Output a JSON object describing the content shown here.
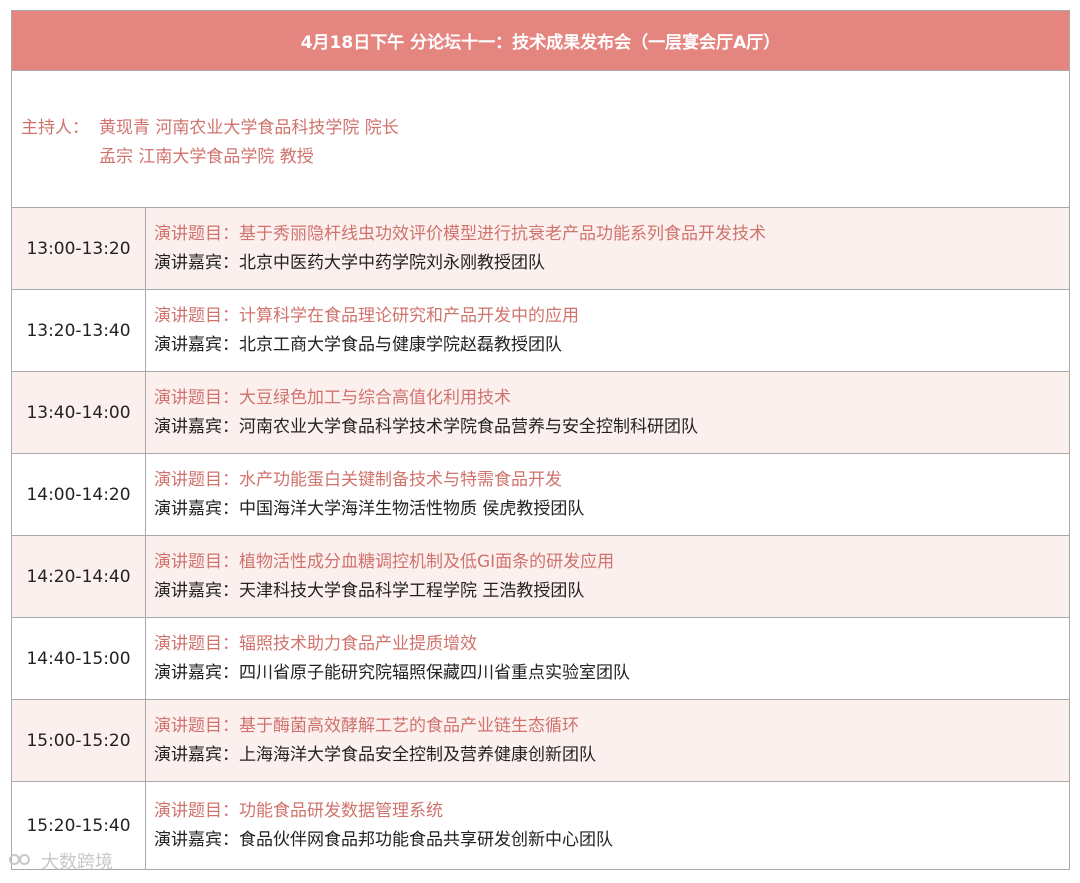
{
  "header": {
    "title": "4月18日下午 分论坛十一：技术成果发布会（一层宴会厅A厅）"
  },
  "hosts": {
    "label": "主持人：",
    "lines": [
      "黄现青 河南农业大学食品科技学院 院长",
      "孟宗 江南大学食品学院 教授"
    ]
  },
  "sessions": [
    {
      "time": "13:00-13:20",
      "topic": "演讲题目：基于秀丽隐杆线虫功效评价模型进行抗衰老产品功能系列食品开发技术",
      "speaker": "演讲嘉宾：北京中医药大学中药学院刘永刚教授团队"
    },
    {
      "time": "13:20-13:40",
      "topic": "演讲题目：计算科学在食品理论研究和产品开发中的应用",
      "speaker": "演讲嘉宾：北京工商大学食品与健康学院赵磊教授团队"
    },
    {
      "time": "13:40-14:00",
      "topic": "演讲题目：大豆绿色加工与综合高值化利用技术",
      "speaker": "演讲嘉宾：河南农业大学食品科学技术学院食品营养与安全控制科研团队"
    },
    {
      "time": "14:00-14:20",
      "topic": "演讲题目：水产功能蛋白关键制备技术与特需食品开发",
      "speaker": "演讲嘉宾：中国海洋大学海洋生物活性物质 侯虎教授团队"
    },
    {
      "time": "14:20-14:40",
      "topic": "演讲题目：植物活性成分血糖调控机制及低GI面条的研发应用",
      "speaker": "演讲嘉宾：天津科技大学食品科学工程学院 王浩教授团队"
    },
    {
      "time": "14:40-15:00",
      "topic": "演讲题目：辐照技术助力食品产业提质增效",
      "speaker": "演讲嘉宾：四川省原子能研究院辐照保藏四川省重点实验室团队"
    },
    {
      "time": "15:00-15:20",
      "topic": "演讲题目：基于酶菌高效酵解工艺的食品产业链生态循环",
      "speaker": "演讲嘉宾：上海海洋大学食品安全控制及营养健康创新团队"
    },
    {
      "time": "15:20-15:40",
      "topic": "演讲题目：功能食品研发数据管理系统",
      "speaker": "演讲嘉宾：食品伙伴网食品邦功能食品共享研发创新中心团队"
    }
  ],
  "watermark": {
    "text": "大数跨境"
  },
  "colors": {
    "accent": "#e5857f",
    "topic": "#d0736d",
    "shade": "#fcf0ef"
  }
}
